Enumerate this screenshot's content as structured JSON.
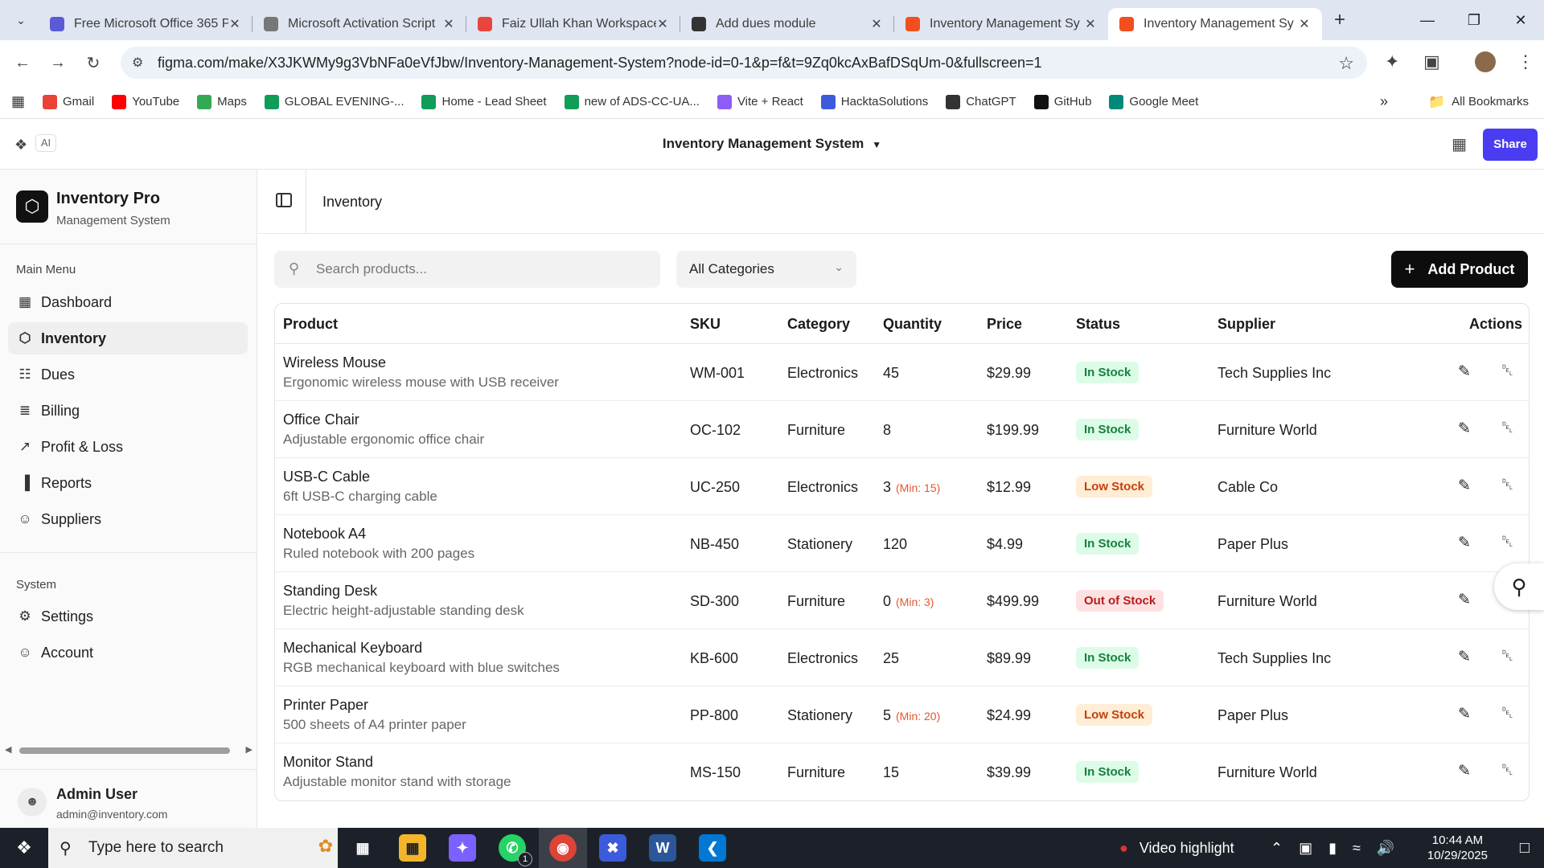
{
  "browser": {
    "tabs": [
      {
        "title": "Free Microsoft Office 365 P",
        "color": "#5b5bd6"
      },
      {
        "title": "Microsoft Activation Script",
        "color": "#777777"
      },
      {
        "title": "Faiz Ullah Khan Workspace",
        "color": "#e8453c"
      },
      {
        "title": "Add dues module",
        "color": "#333333"
      },
      {
        "title": "Inventory Management Sy",
        "color": "#f24e1e"
      },
      {
        "title": "Inventory Management Sy",
        "color": "#f24e1e"
      }
    ],
    "url": "figma.com/make/X3JKWMy9g3VbNFa0eVfJbw/Inventory-Management-System?node-id=0-1&p=f&t=9Zq0kcAxBafDSqUm-0&fullscreen=1",
    "bookmarks": [
      {
        "label": "Gmail",
        "color": "#ea4335"
      },
      {
        "label": "YouTube",
        "color": "#ff0000"
      },
      {
        "label": "Maps",
        "color": "#34a853"
      },
      {
        "label": "GLOBAL EVENING-...",
        "color": "#0f9d58"
      },
      {
        "label": "Home - Lead Sheet",
        "color": "#0f9d58"
      },
      {
        "label": "new of ADS-CC-UA...",
        "color": "#0f9d58"
      },
      {
        "label": "Vite + React",
        "color": "#8e5cf7"
      },
      {
        "label": "HacktaSolutions",
        "color": "#3b5bdb"
      },
      {
        "label": "ChatGPT",
        "color": "#333333"
      },
      {
        "label": "GitHub",
        "color": "#111111"
      },
      {
        "label": "Google Meet",
        "color": "#00897b"
      }
    ],
    "all_bookmarks": "All Bookmarks"
  },
  "figma": {
    "ai_label": "AI",
    "title": "Inventory Management System",
    "share_label": "Share"
  },
  "sidebar": {
    "brand_name": "Inventory Pro",
    "brand_sub": "Management System",
    "main_menu_label": "Main Menu",
    "main_items": [
      {
        "label": "Dashboard",
        "icon": "grid-icon"
      },
      {
        "label": "Inventory",
        "icon": "box-icon"
      },
      {
        "label": "Dues",
        "icon": "receipt-icon"
      },
      {
        "label": "Billing",
        "icon": "file-icon"
      },
      {
        "label": "Profit & Loss",
        "icon": "trend-icon"
      },
      {
        "label": "Reports",
        "icon": "bar-chart-icon"
      },
      {
        "label": "Suppliers",
        "icon": "users-icon"
      }
    ],
    "system_label": "System",
    "system_items": [
      {
        "label": "Settings",
        "icon": "gear-icon"
      },
      {
        "label": "Account",
        "icon": "user-icon"
      }
    ],
    "user_name": "Admin User",
    "user_email": "admin@inventory.com"
  },
  "main": {
    "page_title": "Inventory",
    "search_placeholder": "Search products...",
    "category_value": "All Categories",
    "add_button_label": "Add Product",
    "columns": [
      "Product",
      "SKU",
      "Category",
      "Quantity",
      "Price",
      "Status",
      "Supplier",
      "Actions"
    ],
    "rows": [
      {
        "name": "Wireless Mouse",
        "desc": "Ergonomic wireless mouse with USB receiver",
        "sku": "WM-001",
        "category": "Electronics",
        "qty": "45",
        "min": "",
        "price": "$29.99",
        "status": "In Stock",
        "supplier": "Tech Supplies Inc"
      },
      {
        "name": "Office Chair",
        "desc": "Adjustable ergonomic office chair",
        "sku": "OC-102",
        "category": "Furniture",
        "qty": "8",
        "min": "",
        "price": "$199.99",
        "status": "In Stock",
        "supplier": "Furniture World"
      },
      {
        "name": "USB-C Cable",
        "desc": "6ft USB-C charging cable",
        "sku": "UC-250",
        "category": "Electronics",
        "qty": "3",
        "min": "(Min: 15)",
        "price": "$12.99",
        "status": "Low Stock",
        "supplier": "Cable Co"
      },
      {
        "name": "Notebook A4",
        "desc": "Ruled notebook with 200 pages",
        "sku": "NB-450",
        "category": "Stationery",
        "qty": "120",
        "min": "",
        "price": "$4.99",
        "status": "In Stock",
        "supplier": "Paper Plus"
      },
      {
        "name": "Standing Desk",
        "desc": "Electric height-adjustable standing desk",
        "sku": "SD-300",
        "category": "Furniture",
        "qty": "0",
        "min": "(Min: 3)",
        "price": "$499.99",
        "status": "Out of Stock",
        "supplier": "Furniture World"
      },
      {
        "name": "Mechanical Keyboard",
        "desc": "RGB mechanical keyboard with blue switches",
        "sku": "KB-600",
        "category": "Electronics",
        "qty": "25",
        "min": "",
        "price": "$89.99",
        "status": "In Stock",
        "supplier": "Tech Supplies Inc"
      },
      {
        "name": "Printer Paper",
        "desc": "500 sheets of A4 printer paper",
        "sku": "PP-800",
        "category": "Stationery",
        "qty": "5",
        "min": "(Min: 20)",
        "price": "$24.99",
        "status": "Low Stock",
        "supplier": "Paper Plus"
      },
      {
        "name": "Monitor Stand",
        "desc": "Adjustable monitor stand with storage",
        "sku": "MS-150",
        "category": "Furniture",
        "qty": "15",
        "min": "",
        "price": "$39.99",
        "status": "In Stock",
        "supplier": "Furniture World"
      }
    ],
    "status_colors": {
      "In Stock": {
        "bg": "#dcfce7",
        "fg": "#15803d"
      },
      "Low Stock": {
        "bg": "#ffedd5",
        "fg": "#c2410c"
      },
      "Out of Stock": {
        "bg": "#fee2e2",
        "fg": "#b91c1c"
      }
    }
  },
  "taskbar": {
    "search_placeholder": "Type here to search",
    "video_highlight": "Video highlight",
    "whatsapp_badge": "1",
    "time": "10:44 AM",
    "date": "10/29/2025"
  }
}
